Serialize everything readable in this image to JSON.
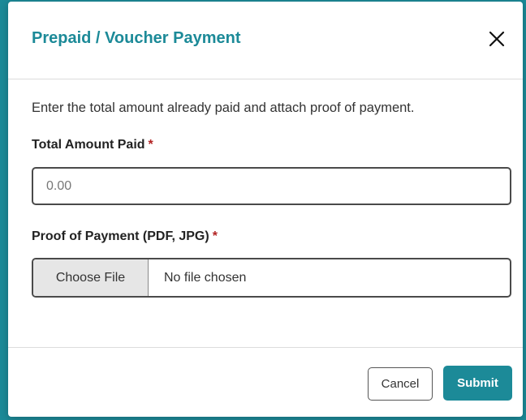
{
  "modal": {
    "title": "Prepaid / Voucher Payment",
    "close_icon": "close-icon",
    "intro": "Enter the total amount already paid and attach proof of payment.",
    "amount": {
      "label": "Total Amount Paid",
      "required_mark": "*",
      "placeholder": "0.00",
      "value": ""
    },
    "proof": {
      "label": "Proof of Payment (PDF, JPG)",
      "required_mark": "*",
      "choose_label": "Choose File",
      "status": "No file chosen"
    },
    "footer": {
      "cancel_label": "Cancel",
      "submit_label": "Submit"
    }
  },
  "colors": {
    "accent": "#1c8a98",
    "required": "#b22222"
  }
}
